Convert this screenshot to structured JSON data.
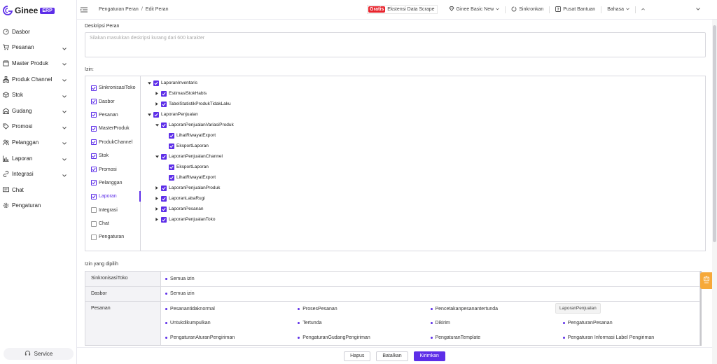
{
  "app": {
    "name": "Ginee",
    "badge": "ERP"
  },
  "sidebar": {
    "items": [
      {
        "label": "Dasbor",
        "icon": "dashboard-icon",
        "has_chevron": false
      },
      {
        "label": "Pesanan",
        "icon": "cart-icon",
        "has_chevron": true
      },
      {
        "label": "Master Produk",
        "icon": "box-icon",
        "has_chevron": true
      },
      {
        "label": "Produk Channel",
        "icon": "channel-icon",
        "has_chevron": true
      },
      {
        "label": "Stok",
        "icon": "cube-icon",
        "has_chevron": true
      },
      {
        "label": "Gudang",
        "icon": "warehouse-icon",
        "has_chevron": true
      },
      {
        "label": "Promosi",
        "icon": "tag-icon",
        "has_chevron": true
      },
      {
        "label": "Pelanggan",
        "icon": "users-icon",
        "has_chevron": true
      },
      {
        "label": "Laporan",
        "icon": "bar-chart-icon",
        "has_chevron": true
      },
      {
        "label": "Integrasi",
        "icon": "link-icon",
        "has_chevron": true
      },
      {
        "label": "Chat",
        "icon": "chat-icon",
        "has_chevron": false
      },
      {
        "label": "Pengaturan",
        "icon": "gear-icon",
        "has_chevron": false
      }
    ],
    "service_label": "Service"
  },
  "header": {
    "breadcrumb": [
      "Pengaturan Peran",
      "Edit Peran"
    ],
    "promo_badge": "Gratis",
    "promo_text": "Ekstensi Data Scrape",
    "plan": "Ginee Basic New",
    "sync": "Sinkronkan",
    "help": "Pusat Bantuan",
    "language": "Bahasa"
  },
  "form": {
    "description_label": "Deskripsi Peran",
    "description_placeholder": "Silakan masukkan deskripsi kurang dari 600 karakter",
    "permission_label": "Izin:",
    "selected_label": "Izin yang dipilih"
  },
  "categories": [
    {
      "label": "SinkronisasiToko",
      "checked": true,
      "active": false
    },
    {
      "label": "Dasbor",
      "checked": true,
      "active": false
    },
    {
      "label": "Pesanan",
      "checked": true,
      "active": false
    },
    {
      "label": "MasterProduk",
      "checked": true,
      "active": false
    },
    {
      "label": "ProdukChannel",
      "checked": true,
      "active": false
    },
    {
      "label": "Stok",
      "checked": true,
      "active": false
    },
    {
      "label": "Promosi",
      "checked": true,
      "active": false
    },
    {
      "label": "Pelanggan",
      "checked": true,
      "active": false
    },
    {
      "label": "Laporan",
      "checked": true,
      "active": true
    },
    {
      "label": "Integrasi",
      "checked": false,
      "active": false
    },
    {
      "label": "Chat",
      "checked": false,
      "active": false
    },
    {
      "label": "Pengaturan",
      "checked": false,
      "active": false
    }
  ],
  "tree": [
    {
      "label": "LaporanInventaris",
      "level": 0,
      "caret": "down"
    },
    {
      "label": "EstimasiStokHabis",
      "level": 1,
      "caret": "right"
    },
    {
      "label": "TabelStatistikProdukTidakLaku",
      "level": 1,
      "caret": "right"
    },
    {
      "label": "LaporanPenjualan",
      "level": 0,
      "caret": "down"
    },
    {
      "label": "LaporanPenjualanVariasiProduk",
      "level": 1,
      "caret": "down"
    },
    {
      "label": "LihatRiwayatExport",
      "level": 2,
      "caret": "none"
    },
    {
      "label": "EksportLaporan",
      "level": 2,
      "caret": "none"
    },
    {
      "label": "LaporanPenjualanChannel",
      "level": 1,
      "caret": "down"
    },
    {
      "label": "EksportLaporan",
      "level": 2,
      "caret": "none"
    },
    {
      "label": "LihatRiwayatExport",
      "level": 2,
      "caret": "none"
    },
    {
      "label": "LaporanPenjualanProduk",
      "level": 1,
      "caret": "right"
    },
    {
      "label": "LaporanLabaRugi",
      "level": 1,
      "caret": "right"
    },
    {
      "label": "LaporanPesanan",
      "level": 1,
      "caret": "right"
    },
    {
      "label": "LaporanPenjualanToko",
      "level": 1,
      "caret": "right"
    }
  ],
  "selected": [
    {
      "name": "SinkronisasiToko",
      "items": [
        "Semua izin"
      ]
    },
    {
      "name": "Dasbor",
      "items": [
        "Semua izin"
      ]
    },
    {
      "name": "Pesanan",
      "items": [
        "Pesanantidaknormal",
        "ProsesPesanan",
        "Pencetakanpesanantertunda",
        "Disimpan",
        "Untukdikumpulkan",
        "Tertunda",
        "Dikirim",
        "PengaturanPesanan",
        "PengaturanAturanPengiriman",
        "PengaturanGudangPengiriman",
        "PengaturanTemplate",
        "Pengaturan Informasi Label Pengiriman"
      ]
    }
  ],
  "tooltip": "LaporanPenjualan",
  "footer": {
    "delete": "Hapus",
    "cancel": "Batalkan",
    "submit": "Kirimkan"
  },
  "colors": {
    "accent": "#5d2ee8",
    "promo": "#e8242d",
    "float_button": "#f6a93a"
  }
}
